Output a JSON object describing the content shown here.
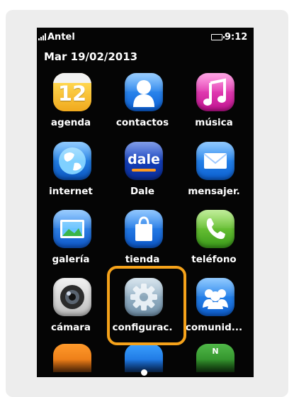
{
  "status_bar": {
    "carrier": "Antel",
    "time": "9:12"
  },
  "home": {
    "date": "Mar 19/02/2013",
    "apps": [
      {
        "label": "agenda",
        "icon": "calendar-icon",
        "day": "12"
      },
      {
        "label": "contactos",
        "icon": "contacts-icon"
      },
      {
        "label": "música",
        "icon": "music-note-icon"
      },
      {
        "label": "internet",
        "icon": "globe-icon"
      },
      {
        "label": "Dale",
        "icon": "dale-icon",
        "text": "dale"
      },
      {
        "label": "mensajer.",
        "icon": "envelope-icon"
      },
      {
        "label": "galería",
        "icon": "photo-gallery-icon"
      },
      {
        "label": "tienda",
        "icon": "shopping-bag-icon"
      },
      {
        "label": "teléfono",
        "icon": "phone-handset-icon"
      },
      {
        "label": "cámara",
        "icon": "camera-lens-icon"
      },
      {
        "label": "configurac.",
        "icon": "gear-icon"
      },
      {
        "label": "comunid...",
        "icon": "community-people-icon"
      }
    ],
    "partial_row": [
      "N"
    ],
    "highlighted_app": "configurac."
  },
  "colors": {
    "highlight": "#f5a21a",
    "screen_bg": "#050505"
  }
}
